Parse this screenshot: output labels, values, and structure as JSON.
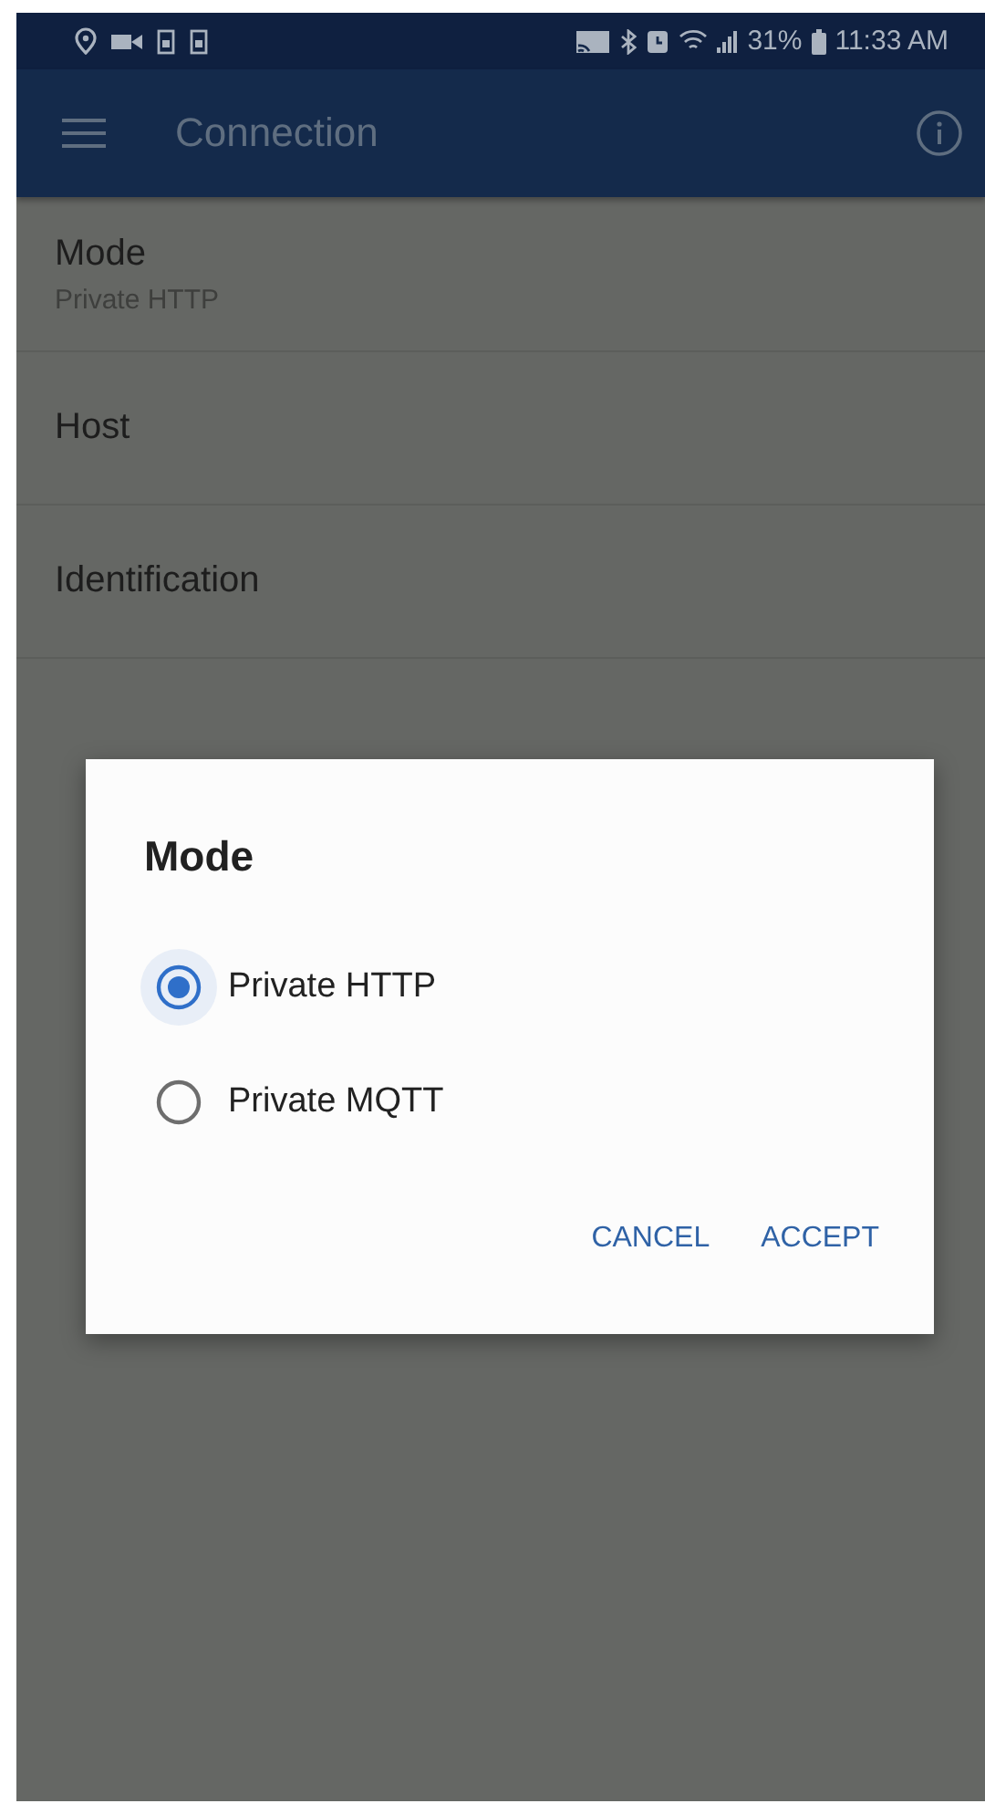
{
  "status_bar": {
    "battery": "31%",
    "time": "11:33 AM"
  },
  "app_bar": {
    "title": "Connection"
  },
  "settings": [
    {
      "title": "Mode",
      "subtitle": "Private HTTP"
    },
    {
      "title": "Host"
    },
    {
      "title": "Identification"
    }
  ],
  "dialog": {
    "title": "Mode",
    "options": [
      {
        "label": "Private HTTP",
        "selected": true
      },
      {
        "label": "Private MQTT",
        "selected": false
      }
    ],
    "buttons": [
      "CANCEL",
      "ACCEPT"
    ]
  }
}
